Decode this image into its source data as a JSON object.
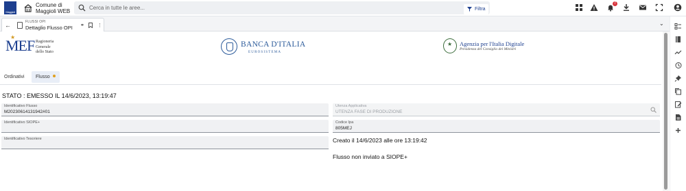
{
  "header": {
    "logo_text": "Maggioli",
    "org_line1": "Comune di",
    "org_line2": "Maggioli WEB",
    "search_placeholder": "Cerca in tutte le aree...",
    "filter_label": "Filtra",
    "notification_count": "7",
    "icons": [
      "apps-icon",
      "warning-icon",
      "bell-icon",
      "download-icon",
      "mail-icon",
      "fullscreen-icon",
      "account-icon"
    ]
  },
  "tab": {
    "subtitle": "FLUSSI OPI",
    "title": "Dettaglio Flusso OPI"
  },
  "logos": {
    "mef_abbr": "MEF",
    "mef_text": [
      "Ragioneria",
      "Generale",
      "dello Stato"
    ],
    "bdi_name": "BANCA D'ITALIA",
    "bdi_sub": "EUROSISTEMA",
    "agid_name": "Agenzia per l'Italia Digitale",
    "agid_sub": "Presidenza del Consiglio dei Ministri"
  },
  "subtabs": {
    "ordinativi": "Ordinativi",
    "flusso": "Flusso"
  },
  "main": {
    "status": "STATO : EMESSO IL 14/6/2023, 13:19:47",
    "fields": {
      "identificativo_flusso": {
        "label": "Identificativo Flusso",
        "value": "M20230614131942#01"
      },
      "identificativo_siope": {
        "label": "Identificativo SIOPE+",
        "value": ""
      },
      "identificativo_tesoriere": {
        "label": "Identificativo Tesoriere",
        "value": ""
      },
      "utenza_applicativa": {
        "label": "Utenza Applicativa",
        "value": "UTENZA FASE DI PRODUZIONE"
      },
      "codice_ipa": {
        "label": "Codice Ipa",
        "value": "805MEJ"
      }
    },
    "created": "Creato il 14/6/2023 alle ore 13:19:42",
    "siope_status": "Flusso non inviato a SIOPE+"
  },
  "rail_icons": [
    "list-icon",
    "book-icon",
    "chart-icon",
    "history-icon",
    "pin-icon",
    "copy-icon",
    "edit-icon",
    "file-icon",
    "add-icon"
  ],
  "colors": {
    "brand": "#1d3f8f",
    "accent_dot": "#e0a020",
    "badge": "#d9363e"
  }
}
